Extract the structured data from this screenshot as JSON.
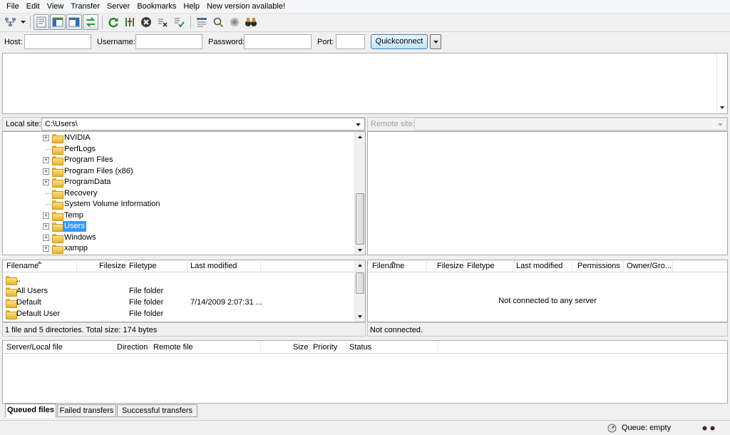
{
  "menu": [
    "File",
    "Edit",
    "View",
    "Transfer",
    "Server",
    "Bookmarks",
    "Help",
    "New version available!"
  ],
  "toolbar_icons": [
    "site-manager-icon",
    "dropdown-arrow-icon",
    "toggle-message-log-icon",
    "toggle-local-tree-icon",
    "toggle-remote-tree-icon",
    "toggle-queue-icon",
    "refresh-icon",
    "process-queue-icon",
    "cancel-icon",
    "disconnect-icon",
    "reconnect-icon",
    "directory-listing-filter-icon",
    "search-icon",
    "compare-icon",
    "binoculars-icon"
  ],
  "quickconnect": {
    "host_label": "Host:",
    "host_value": "",
    "username_label": "Username:",
    "username_value": "",
    "password_label": "Password:",
    "password_value": "",
    "port_label": "Port:",
    "port_value": "",
    "button": "Quickconnect"
  },
  "local": {
    "site_label": "Local site:",
    "site_path": "C:\\Users\\",
    "tree": [
      {
        "label": "NVIDIA",
        "expandable": true,
        "selected": false
      },
      {
        "label": "PerfLogs",
        "expandable": false,
        "selected": false
      },
      {
        "label": "Program Files",
        "expandable": true,
        "selected": false
      },
      {
        "label": "Program Files (x86)",
        "expandable": true,
        "selected": false
      },
      {
        "label": "ProgramData",
        "expandable": true,
        "selected": false
      },
      {
        "label": "Recovery",
        "expandable": false,
        "selected": false
      },
      {
        "label": "System Volume Information",
        "expandable": false,
        "selected": false
      },
      {
        "label": "Temp",
        "expandable": true,
        "selected": false
      },
      {
        "label": "Users",
        "expandable": true,
        "selected": true
      },
      {
        "label": "Windows",
        "expandable": true,
        "selected": false
      },
      {
        "label": "xampp",
        "expandable": true,
        "selected": false
      }
    ],
    "columns": [
      "Filename",
      "Filesize",
      "Filetype",
      "Last modified"
    ],
    "files": [
      {
        "name": "..",
        "size": "",
        "type": "",
        "modified": ""
      },
      {
        "name": "All Users",
        "size": "",
        "type": "File folder",
        "modified": ""
      },
      {
        "name": "Default",
        "size": "",
        "type": "File folder",
        "modified": "7/14/2009 2:07:31 ..."
      },
      {
        "name": "Default User",
        "size": "",
        "type": "File folder",
        "modified": ""
      }
    ],
    "status": "1 file and 5 directories. Total size: 174 bytes"
  },
  "remote": {
    "site_label": "Remote site:",
    "site_path": "",
    "columns": [
      "Filename",
      "Filesize",
      "Filetype",
      "Last modified",
      "Permissions",
      "Owner/Gro..."
    ],
    "empty_message": "Not connected to any server",
    "status": "Not connected."
  },
  "queue": {
    "columns": [
      "Server/Local file",
      "Direction",
      "Remote file",
      "Size",
      "Priority",
      "Status"
    ],
    "tabs": [
      "Queued files",
      "Failed transfers",
      "Successful transfers"
    ],
    "active_tab": 0,
    "status": "Queue: empty"
  },
  "colors": {
    "selection": "#3399ff",
    "quickconnect_border": "#3c7fb1"
  }
}
